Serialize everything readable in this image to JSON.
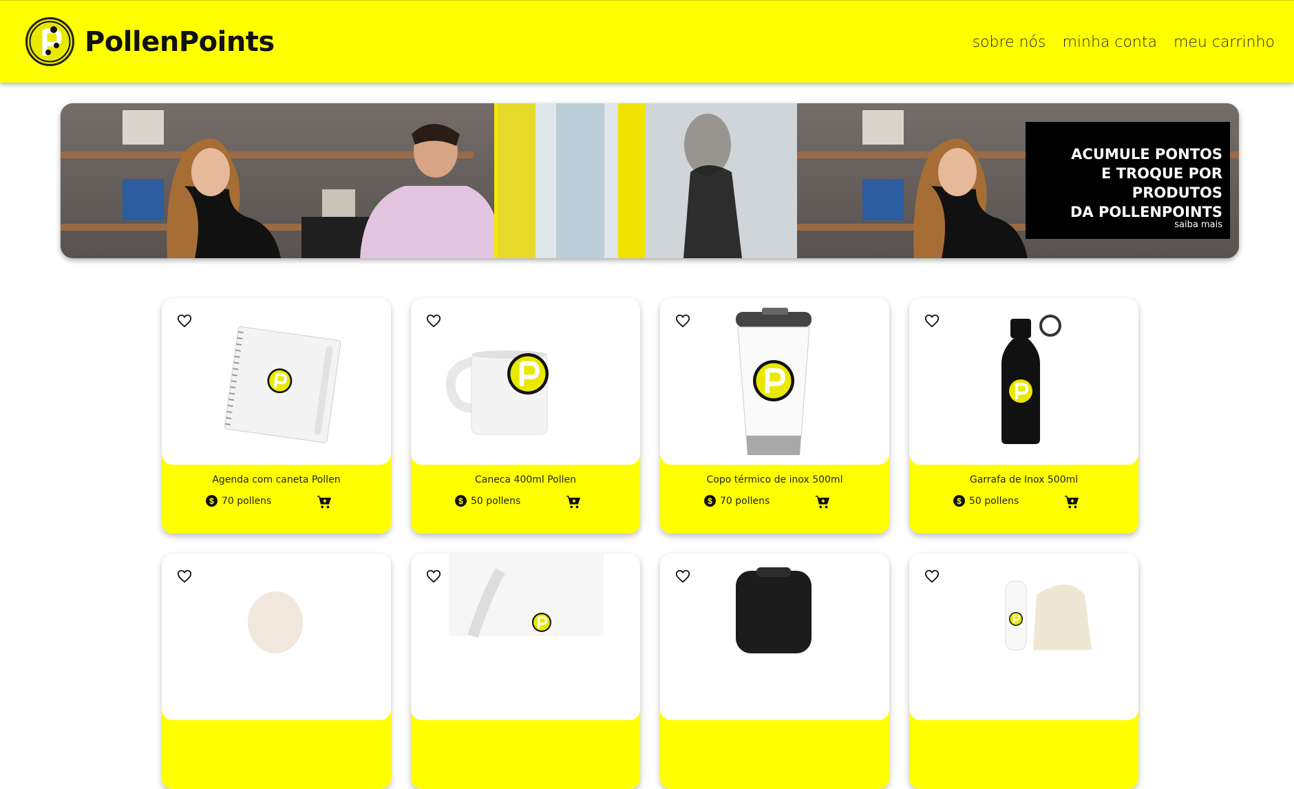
{
  "header": {
    "brand": "PollenPoints",
    "nav": [
      "sobre nós",
      "minha conta",
      "meu carrinho"
    ]
  },
  "banner": {
    "headline": "ACUMULE PONTOS\nE TROQUE POR PRODUTOS\nDA POLLENPOINTS",
    "cta": "saiba mais"
  },
  "products": [
    {
      "name": "Agenda com caneta Pollen",
      "price": "70 pollens",
      "image": "notebook"
    },
    {
      "name": "Caneca 400ml Pollen",
      "price": "50 pollens",
      "image": "mug"
    },
    {
      "name": "Copo térmico de inox 500ml",
      "price": "70 pollens",
      "image": "tumbler"
    },
    {
      "name": "Garrafa de Inox 500ml",
      "price": "50 pollens",
      "image": "bottle"
    },
    {
      "name": "",
      "price": "",
      "image": "cap"
    },
    {
      "name": "",
      "price": "",
      "image": "lanyard"
    },
    {
      "name": "",
      "price": "",
      "image": "backpack"
    },
    {
      "name": "",
      "price": "",
      "image": "kit"
    }
  ],
  "colors": {
    "accent": "#ffff00",
    "text": "#111111"
  },
  "icons": [
    "pollenpoints-logo",
    "heart-icon",
    "coin-icon",
    "cart-add-icon"
  ]
}
